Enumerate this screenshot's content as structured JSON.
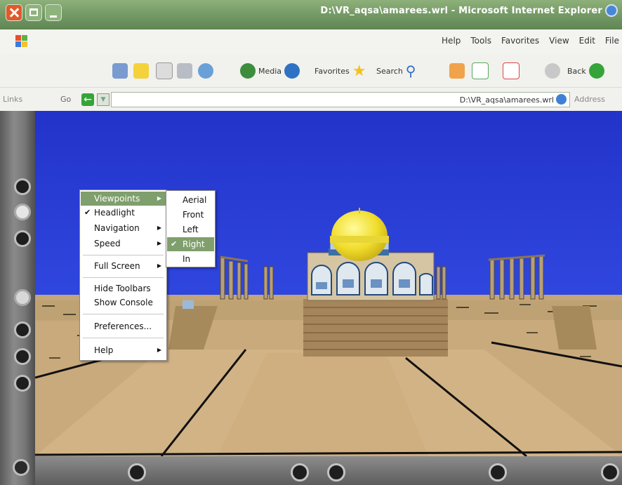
{
  "window": {
    "title": "D:\\VR_aqsa\\amarees.wrl - Microsoft Internet Explorer"
  },
  "menubar": {
    "items": [
      "Help",
      "Tools",
      "Favorites",
      "View",
      "Edit",
      "File"
    ]
  },
  "toolbar": {
    "media_label": "Media",
    "favorites_label": "Favorites",
    "search_label": "Search",
    "back_label": "Back"
  },
  "addressbar": {
    "links_label": "Links",
    "go_label": "Go",
    "address_value": "D:\\VR_aqsa\\amarees.wrl",
    "address_label": "Address"
  },
  "context_menu": {
    "items": [
      {
        "label": "Viewpoints",
        "submenu": true,
        "checked": false,
        "highlighted": true
      },
      {
        "label": "Headlight",
        "submenu": false,
        "checked": true,
        "highlighted": false
      },
      {
        "label": "Navigation",
        "submenu": true,
        "checked": false,
        "highlighted": false
      },
      {
        "label": "Speed",
        "submenu": true,
        "checked": false,
        "highlighted": false
      },
      {
        "label": "Full Screen",
        "submenu": true,
        "checked": false,
        "highlighted": false
      },
      {
        "label": "Hide Toolbars",
        "submenu": false,
        "checked": false,
        "highlighted": false
      },
      {
        "label": "Show Console",
        "submenu": false,
        "checked": false,
        "highlighted": false
      },
      {
        "label": "Preferences...",
        "submenu": false,
        "checked": false,
        "highlighted": false
      },
      {
        "label": "Help",
        "submenu": true,
        "checked": false,
        "highlighted": false
      }
    ]
  },
  "submenu": {
    "items": [
      {
        "label": "Aerial",
        "checked": false,
        "highlighted": false
      },
      {
        "label": "Front",
        "checked": false,
        "highlighted": false
      },
      {
        "label": "Left",
        "checked": false,
        "highlighted": false
      },
      {
        "label": "Right",
        "checked": true,
        "highlighted": true
      },
      {
        "label": "In",
        "checked": false,
        "highlighted": false
      }
    ]
  },
  "colors": {
    "titlebar": "#6f9562",
    "sky": "#2c3fd9",
    "ground": "#c4a677",
    "dome": "#f2e23a",
    "menu_highlight": "#7f9f6c"
  }
}
